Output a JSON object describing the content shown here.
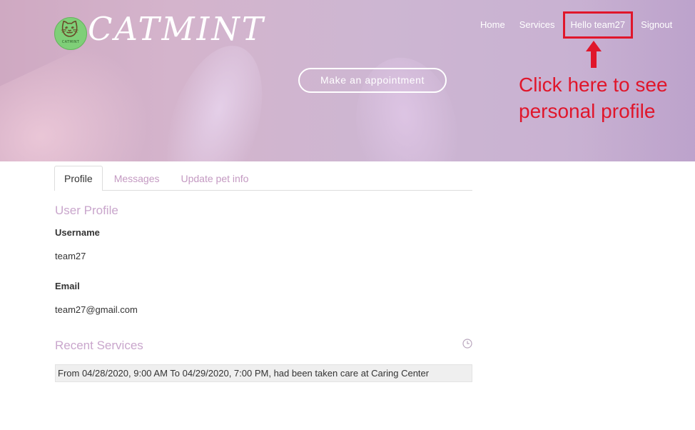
{
  "brand": {
    "name": "CATMINT",
    "badge_text": "CATMINT"
  },
  "nav": {
    "home": "Home",
    "services": "Services",
    "hello": "Hello team27",
    "signout": "Signout"
  },
  "hero": {
    "appointment_button": "Make an appointment"
  },
  "annotation": {
    "text": "Click here to see\npersonal profile",
    "color": "#e0162b"
  },
  "tabs": [
    {
      "label": "Profile",
      "active": true
    },
    {
      "label": "Messages",
      "active": false
    },
    {
      "label": "Update pet info",
      "active": false
    }
  ],
  "profile": {
    "heading": "User Profile",
    "username_label": "Username",
    "username_value": "team27",
    "email_label": "Email",
    "email_value": "team27@gmail.com"
  },
  "recent_services": {
    "heading": "Recent Services",
    "icon": "clock-icon",
    "items": [
      "From 04/28/2020, 9:00 AM To 04/29/2020, 7:00 PM, had been taken care at Caring Center"
    ]
  },
  "colors": {
    "accent": "#c9a6cc",
    "tab_inactive": "#c49ac2",
    "highlight": "#e0162b"
  }
}
